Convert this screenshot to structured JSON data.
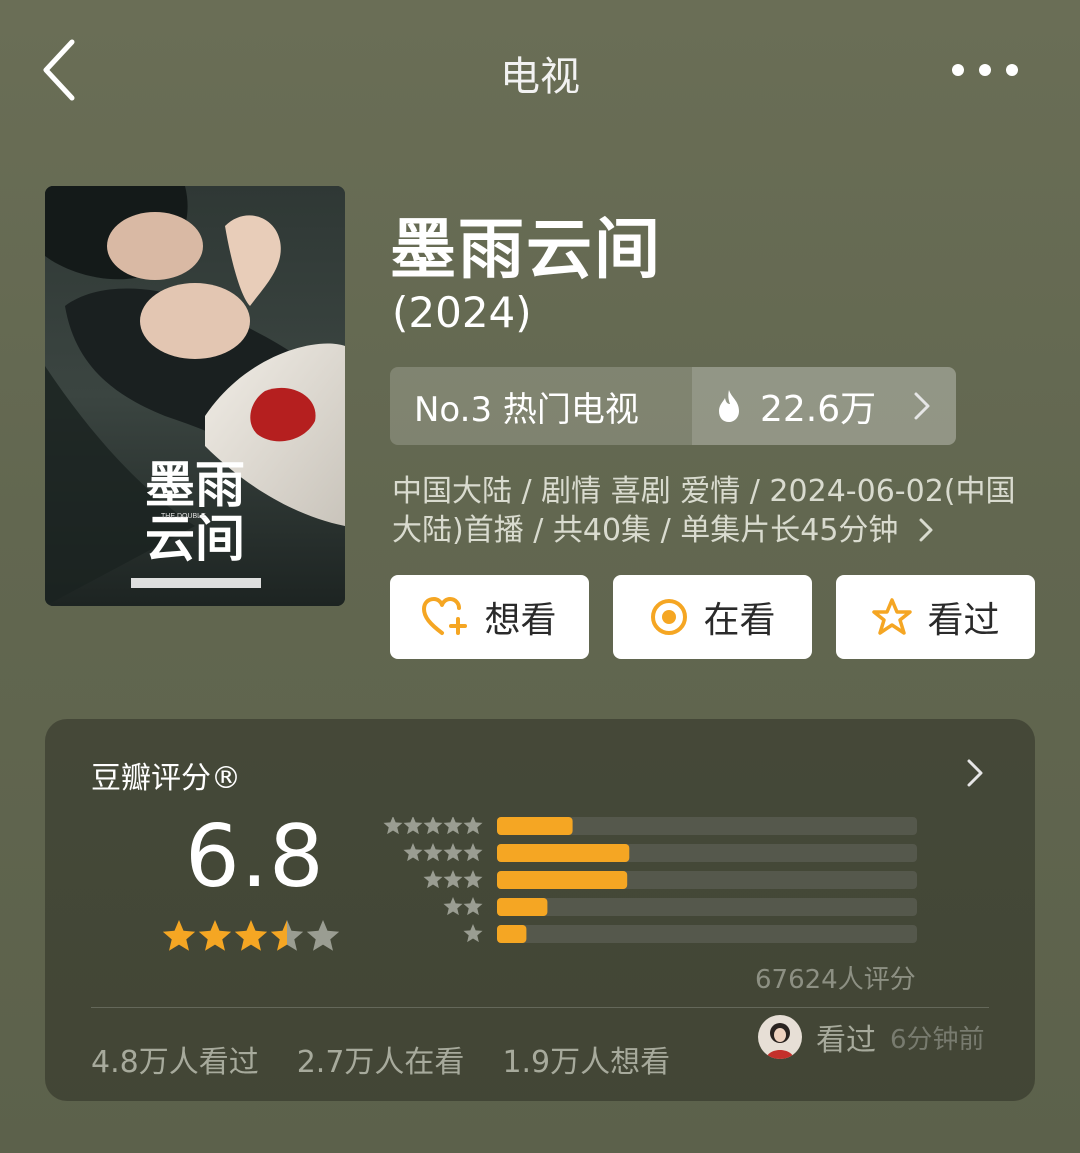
{
  "nav": {
    "title": "电视",
    "back_icon": "chevron-left-icon",
    "more_icon": "more-dots-icon"
  },
  "poster": {
    "title_text": "墨雨云间",
    "subtitle_text": "THE DOUBLE"
  },
  "show": {
    "title": "墨雨云间",
    "year": "(2024)"
  },
  "rank": {
    "label": "No.3 热门电视",
    "heat": "22.6万"
  },
  "meta": {
    "line": "中国大陆 / 剧情 喜剧 爱情 / 2024-06-02(中国大陆)首播 / 共40集 / 单集片长45分钟"
  },
  "actions": [
    {
      "label": "想看",
      "icon": "heart-plus-icon"
    },
    {
      "label": "在看",
      "icon": "target-icon"
    },
    {
      "label": "看过",
      "icon": "star-outline-icon"
    }
  ],
  "rating": {
    "label": "豆瓣评分®",
    "score": "6.8",
    "stars": 3.5,
    "count": "67624人评分",
    "distribution": [
      {
        "stars": 5,
        "fraction": 0.18
      },
      {
        "stars": 4,
        "fraction": 0.315
      },
      {
        "stars": 3,
        "fraction": 0.31
      },
      {
        "stars": 2,
        "fraction": 0.12
      },
      {
        "stars": 1,
        "fraction": 0.07
      }
    ]
  },
  "stats": [
    "4.8万人看过",
    "2.7万人在看",
    "1.9万人想看"
  ],
  "friend": {
    "status": "看过",
    "time": "6分钟前"
  },
  "colors": {
    "accent": "#f5a623",
    "star_gray": "#9a9d92",
    "bar_track": "#55584c"
  }
}
